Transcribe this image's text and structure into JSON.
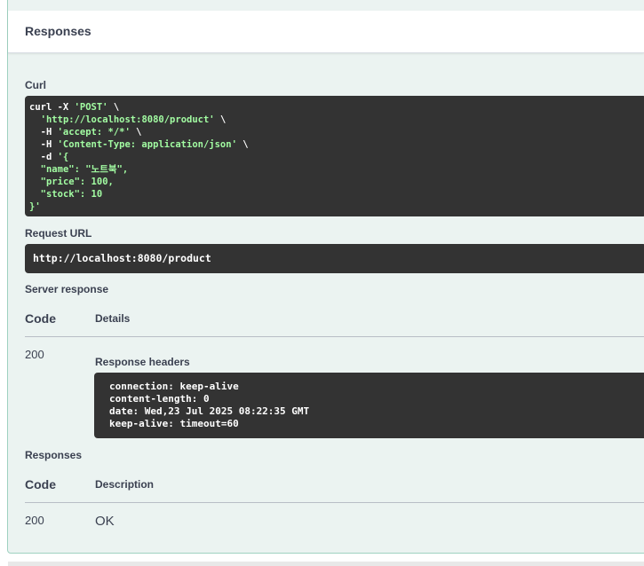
{
  "section": {
    "title": "Responses"
  },
  "curl": {
    "label": "Curl",
    "lines": [
      [
        "curl -X ",
        "'POST'",
        " \\"
      ],
      [
        "  ",
        "'http://localhost:8080/product'",
        " \\"
      ],
      [
        "  -H ",
        "'accept: */*'",
        " \\"
      ],
      [
        "  -H ",
        "'Content-Type: application/json'",
        " \\"
      ],
      [
        "  -d ",
        "'{",
        ""
      ],
      [
        "  ",
        "\"name\": \"노트북\",",
        ""
      ],
      [
        "  ",
        "\"price\": 100,",
        ""
      ],
      [
        "  ",
        "\"stock\": 10",
        ""
      ],
      [
        "",
        "}'",
        ""
      ]
    ]
  },
  "request_url": {
    "label": "Request URL",
    "value": "http://localhost:8080/product"
  },
  "server_response": {
    "label": "Server response",
    "col_code": "Code",
    "col_details": "Details",
    "code": "200",
    "headers_label": "Response headers",
    "headers": [
      "connection: keep-alive",
      "content-length: 0",
      "date: Wed,23 Jul 2025 08:22:35 GMT",
      "keep-alive: timeout=60"
    ]
  },
  "responses": {
    "label": "Responses",
    "col_code": "Code",
    "col_description": "Description",
    "code": "200",
    "description": "OK"
  }
}
